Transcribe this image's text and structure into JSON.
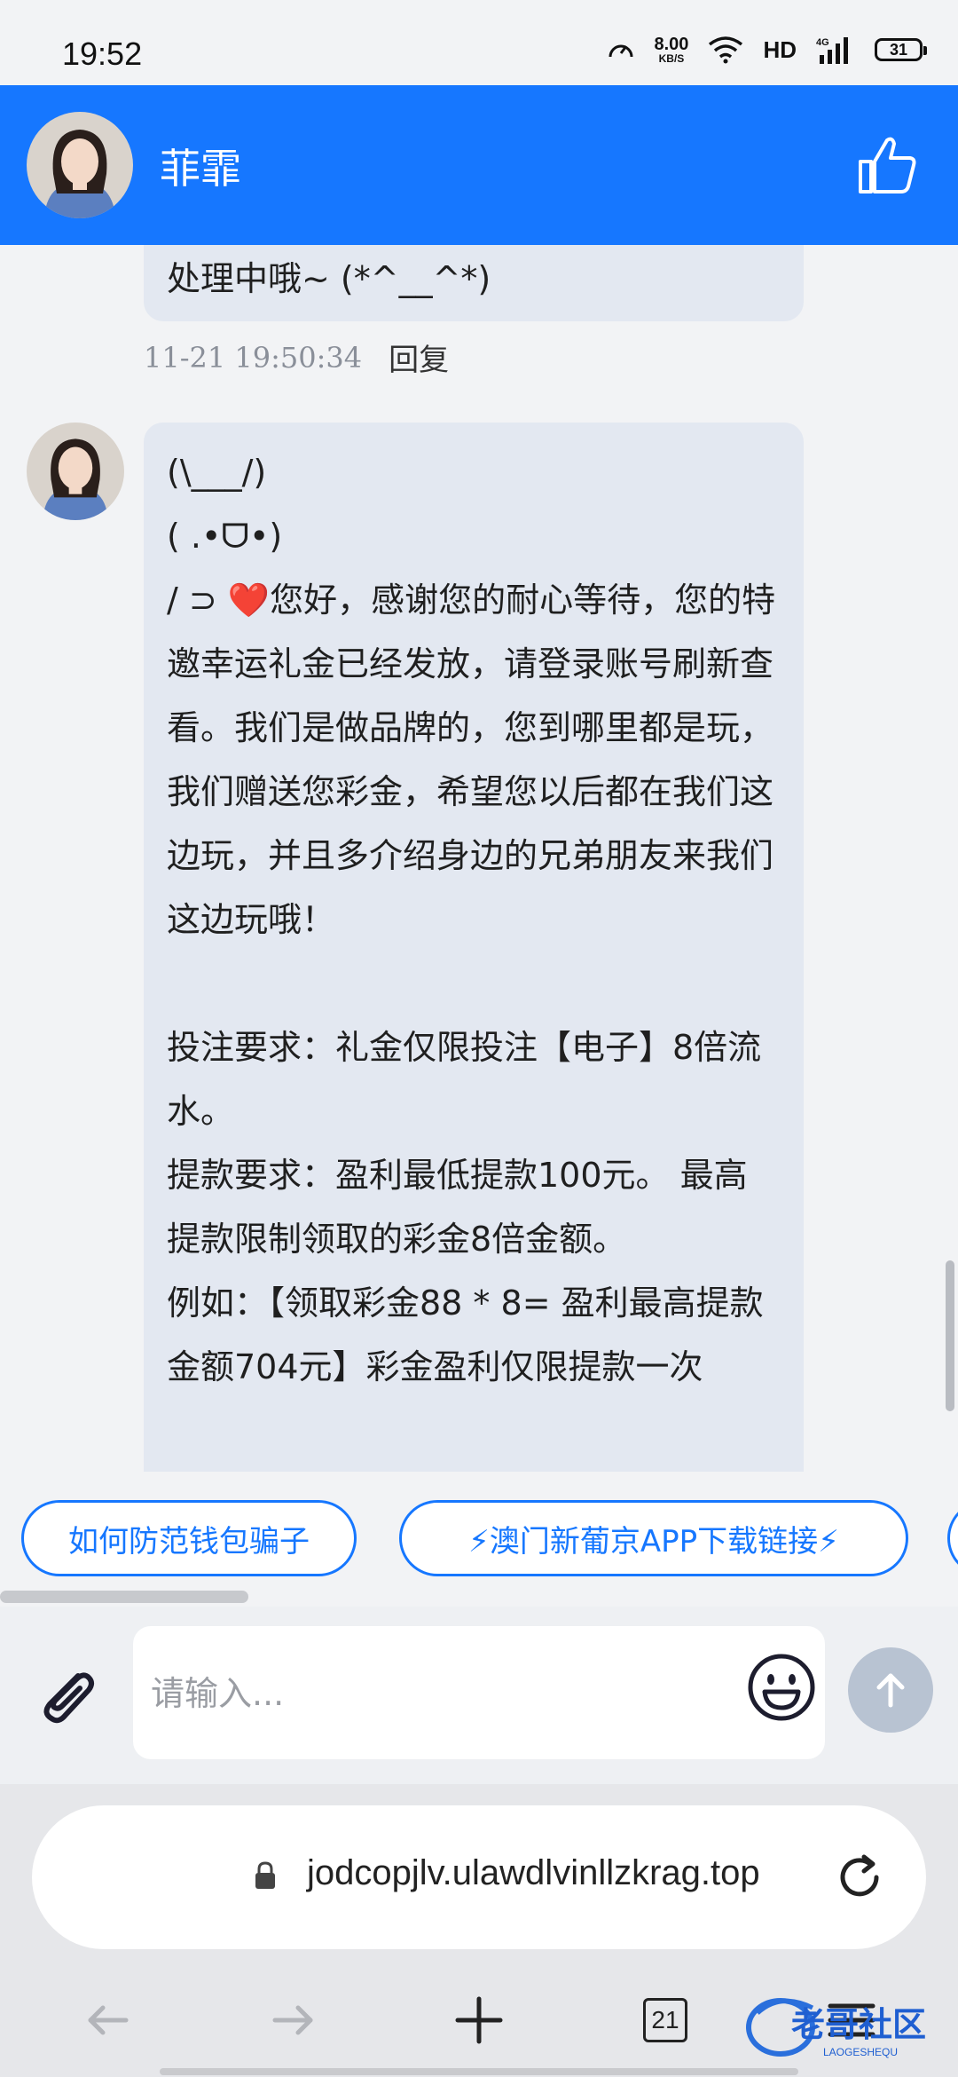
{
  "status_bar": {
    "time": "19:52",
    "net_speed": "8.00",
    "net_speed_unit": "KB/S",
    "hd_label": "HD",
    "network": "4G",
    "battery": "31"
  },
  "header": {
    "contact_name": "菲霏",
    "avatar_icon": "woman-avatar",
    "thumb_icon": "thumb-up-icon"
  },
  "messages": {
    "previous": {
      "text": "处理中哦~ (*^__^*)",
      "time": "11-21 19:50:34",
      "reply_label": "回复"
    },
    "current": {
      "lines": [
        "(\\___/)",
        "( .•ᗜ•)",
        "/ ⊃ ",
        "您好，感谢您的耐心等待，您的特邀幸运礼金已经发放，请登录账号刷新查看。我们是做品牌的，您到哪里都是玩，我们赠送您彩金，希望您以后都在我们这边玩，并且多介绍身边的兄弟朋友来我们这边玩哦！",
        "",
        "投注要求：礼金仅限投注【电子】8倍流水。",
        "提款要求：盈利最低提款100元。 最高提款限制领取的彩金8倍金额。",
        "例如：【领取彩金88 * 8= 盈利最高提款金额704元】彩金盈利仅限提款一次"
      ],
      "heart_glyph": "❤️"
    }
  },
  "quick_replies": [
    {
      "label": "如何防范钱包骗子"
    },
    {
      "label": "⚡澳门新葡京APP下载链接⚡"
    },
    {
      "label": ""
    }
  ],
  "input": {
    "placeholder": "请输入...",
    "value": ""
  },
  "browser": {
    "url": "jodcopjlv.ulawdlvinllzkrag.top",
    "tab_count": "21"
  },
  "watermark": {
    "text": "老哥社区",
    "subtext": "LAOGESHEQU"
  },
  "colors": {
    "accent": "#1677ff",
    "bubble": "#e3e8f1",
    "background": "#f2f3f5"
  }
}
